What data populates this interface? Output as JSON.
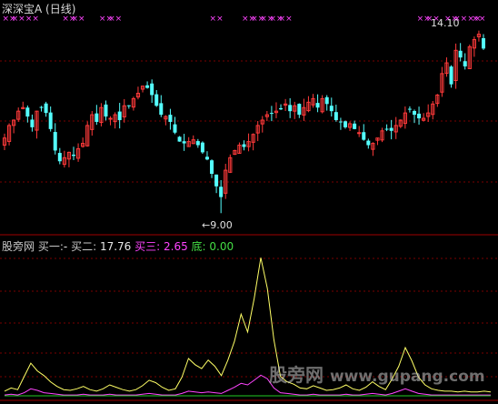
{
  "header": {
    "title": "深深宝A (日线)"
  },
  "indicator_header": {
    "name": "股旁网",
    "sell1_label": "买一:",
    "sell1_value": "-",
    "buy2_label": "买二:",
    "buy2_value": "17.76",
    "buy3_label": "买三:",
    "buy3_value": "2.65",
    "bottom_label": "底:",
    "bottom_value": "0.00"
  },
  "annotations": {
    "high_label": "14.10",
    "low_label": "←9.00"
  },
  "watermark": {
    "text": "股旁网",
    "site": "www.gupang.com"
  },
  "colors": {
    "background": "#000000",
    "up_candle": "#ff3a3a",
    "down_candle": "#54ffff",
    "grid": "#7a0000",
    "frame": "#a00000",
    "signal_marker": "#ff44ff",
    "yellow_line": "#ffff66",
    "magenta_line": "#ff44ff",
    "green_line": "#22cc22"
  },
  "chart_data": [
    {
      "type": "candlestick",
      "title": "深深宝A (日线)",
      "ylim": [
        8.6,
        14.6
      ],
      "high": 14.1,
      "low": 9.0,
      "closes": [
        11.1,
        11.45,
        11.6,
        11.85,
        11.95,
        11.7,
        11.4,
        11.85,
        11.95,
        11.8,
        11.35,
        10.75,
        10.45,
        10.55,
        10.7,
        10.6,
        10.8,
        10.95,
        11.45,
        11.75,
        11.55,
        11.95,
        11.7,
        11.65,
        11.75,
        11.6,
        12.0,
        12.0,
        12.2,
        12.35,
        12.55,
        12.5,
        12.3,
        12.0,
        11.75,
        11.7,
        11.55,
        11.25,
        11.0,
        10.95,
        11.0,
        11.05,
        10.9,
        10.7,
        10.5,
        10.1,
        9.75,
        9.45,
        10.2,
        10.55,
        10.75,
        10.9,
        10.85,
        11.0,
        11.2,
        11.45,
        11.6,
        11.75,
        11.8,
        11.85,
        11.9,
        12.05,
        11.85,
        12.0,
        11.75,
        11.95,
        12.1,
        12.2,
        11.95,
        12.2,
        12.05,
        11.85,
        11.6,
        11.55,
        11.4,
        11.5,
        11.35,
        11.25,
        11.05,
        10.9,
        10.95,
        11.1,
        11.3,
        11.35,
        11.3,
        11.45,
        11.6,
        11.8,
        11.9,
        11.75,
        11.65,
        11.65,
        11.8,
        12.05,
        12.3,
        12.9,
        13.2,
        12.6,
        13.55,
        13.35,
        13.1,
        13.65,
        13.85,
        14.0,
        13.6
      ]
    },
    {
      "type": "line",
      "title": "股旁网",
      "ylim": [
        0,
        20
      ],
      "series": [
        {
          "name": "买二",
          "values": [
            0.6,
            1.0,
            0.8,
            2.5,
            4.2,
            3.2,
            2.6,
            1.8,
            1.2,
            0.8,
            0.7,
            0.9,
            1.2,
            0.8,
            0.6,
            0.9,
            1.4,
            1.1,
            0.8,
            0.6,
            0.8,
            1.3,
            2.0,
            1.7,
            1.1,
            0.7,
            0.9,
            2.4,
            4.8,
            4.0,
            3.5,
            4.6,
            3.8,
            2.6,
            4.6,
            7.0,
            10.5,
            8.2,
            12.5,
            17.76,
            13.8,
            7.2,
            2.5,
            1.8,
            1.5,
            1.0,
            0.9,
            1.3,
            1.0,
            0.7,
            0.8,
            1.0,
            1.4,
            0.9,
            0.7,
            1.1,
            1.8,
            1.2,
            0.8,
            2.2,
            3.8,
            6.2,
            4.5,
            2.4,
            1.4,
            0.9,
            0.7,
            0.6,
            0.6,
            0.5,
            0.6,
            0.5,
            0.5,
            0.6,
            0.5
          ]
        },
        {
          "name": "买三",
          "values": [
            0.1,
            0.2,
            0.1,
            0.4,
            0.9,
            0.7,
            0.4,
            0.3,
            0.2,
            0.1,
            0.1,
            0.1,
            0.2,
            0.1,
            0.1,
            0.1,
            0.2,
            0.1,
            0.1,
            0.1,
            0.1,
            0.2,
            0.3,
            0.2,
            0.1,
            0.1,
            0.1,
            0.3,
            0.6,
            0.5,
            0.4,
            0.5,
            0.4,
            0.3,
            0.7,
            1.1,
            1.6,
            1.4,
            2.0,
            2.65,
            2.2,
            1.0,
            0.4,
            0.3,
            0.2,
            0.1,
            0.1,
            0.2,
            0.1,
            0.1,
            0.1,
            0.1,
            0.2,
            0.1,
            0.1,
            0.2,
            0.3,
            0.2,
            0.1,
            0.3,
            0.6,
            0.9,
            0.6,
            0.3,
            0.2,
            0.1,
            0.1,
            0.1,
            0.1,
            0.1,
            0.1,
            0.1,
            0.1,
            0.1,
            0.1
          ]
        },
        {
          "name": "底",
          "values": [
            0.0,
            0.0,
            0.0,
            0.0,
            0.0,
            0.0,
            0.0,
            0.0,
            0.0,
            0.0
          ]
        }
      ]
    }
  ],
  "signal_markers": {
    "symbol": "××",
    "days": [
      1,
      3,
      6,
      14,
      16,
      22,
      24,
      46,
      53,
      55,
      57,
      59,
      61,
      91,
      93,
      97,
      99,
      102,
      103
    ]
  }
}
